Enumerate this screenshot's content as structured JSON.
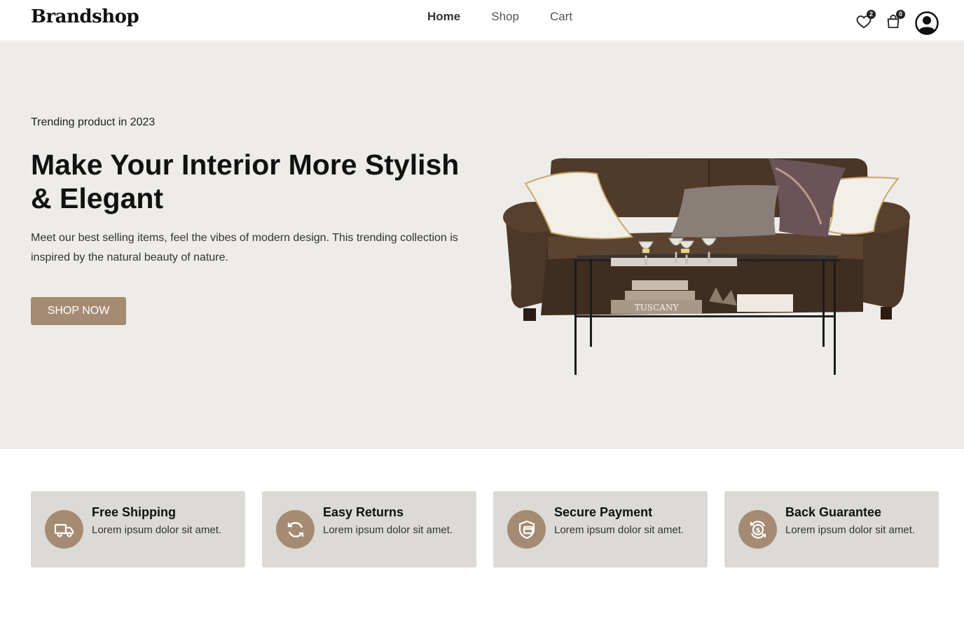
{
  "header": {
    "logo": "Brandshop",
    "nav": [
      "Home",
      "Shop",
      "Cart"
    ],
    "wishlist_count": "2",
    "cart_count": "0"
  },
  "hero": {
    "subtitle": "Trending product in 2023",
    "title": "Make Your Interior More Stylish & Elegant",
    "text": "Meet our best selling items, feel the vibes of modern design. This trending collection is inspired by the natural beauty of nature.",
    "button": "SHOP NOW",
    "image_alt_label": "TUSCANY"
  },
  "features": [
    {
      "title": "Free Shipping",
      "text": "Lorem ipsum dolor sit amet.",
      "icon": "truck-icon"
    },
    {
      "title": "Easy Returns",
      "text": "Lorem ipsum dolor sit amet.",
      "icon": "refresh-icon"
    },
    {
      "title": "Secure Payment",
      "text": "Lorem ipsum dolor sit amet.",
      "icon": "shield-card-icon"
    },
    {
      "title": "Back Guarantee",
      "text": "Lorem ipsum dolor sit amet.",
      "icon": "money-back-icon"
    }
  ],
  "colors": {
    "accent": "#a58b73",
    "hero_bg": "#eeece9",
    "card_bg": "#dcdad6"
  }
}
